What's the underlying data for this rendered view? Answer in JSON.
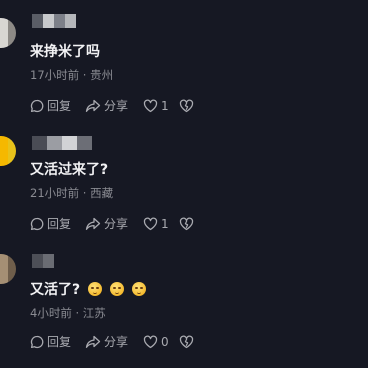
{
  "comments": [
    {
      "text": "来挣米了吗",
      "time": "17小时前",
      "sep": " · ",
      "location": "贵州",
      "reply_label": "回复",
      "share_label": "分享",
      "likes": "1",
      "avatar_colors": [
        "#d8d6d2",
        "#8d8a86",
        "#4a4844"
      ],
      "username_colors": [
        "#5a5d66",
        "#c8c9cc",
        "#7d8089",
        "#b4b6ba"
      ],
      "emojis": []
    },
    {
      "text": "又活过来了?",
      "time": "21小时前",
      "sep": " · ",
      "location": "西藏",
      "reply_label": "回复",
      "share_label": "分享",
      "likes": "1",
      "avatar_colors": [
        "#f5b800",
        "#e8c21a",
        "#c79600"
      ],
      "username_colors": [
        "#4a4c55",
        "#9b9da3",
        "#d2d3d6",
        "#6c6e76"
      ],
      "emojis": []
    },
    {
      "text": "又活了?",
      "time": "4小时前",
      "sep": " · ",
      "location": "江苏",
      "reply_label": "回复",
      "share_label": "分享",
      "likes": "0",
      "avatar_colors": [
        "#a58f74",
        "#6f5e4b",
        "#c6b49a"
      ],
      "username_colors": [
        "#4d4f57",
        "#6a6c73"
      ],
      "emojis": [
        "sleepy-face-emoji",
        "sleepy-face-emoji",
        "sleepy-face-emoji"
      ]
    }
  ],
  "icons": {
    "reply": "speech-bubble-icon",
    "share": "share-arrow-icon",
    "like": "heart-icon",
    "dislike": "broken-heart-icon"
  },
  "colors": {
    "background": "#161823",
    "text_primary": "#f2f2f4",
    "text_secondary": "#8a8b92",
    "action": "#a9aab0"
  }
}
